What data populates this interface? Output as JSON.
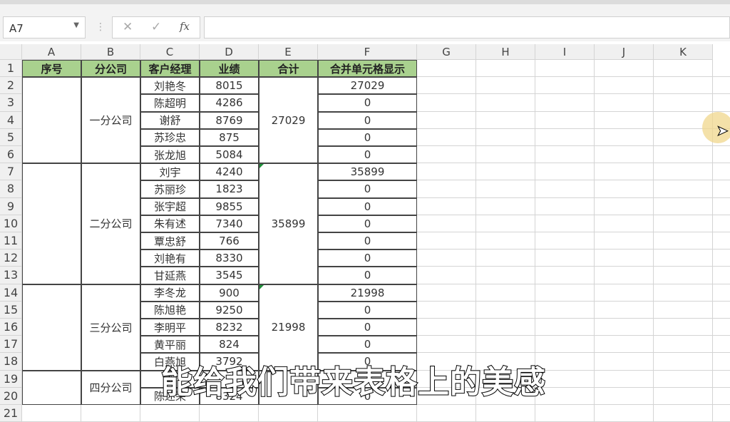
{
  "namebox": {
    "value": "A7"
  },
  "formula": {
    "cancel_icon": "✕",
    "enter_icon": "✓",
    "fx_label": "fx",
    "value": ""
  },
  "columns": [
    "A",
    "B",
    "C",
    "D",
    "E",
    "F",
    "G",
    "H",
    "I",
    "J",
    "K"
  ],
  "rows": [
    "1",
    "2",
    "3",
    "4",
    "5",
    "6",
    "7",
    "8",
    "9",
    "10",
    "11",
    "12",
    "13",
    "14",
    "15",
    "16",
    "17",
    "18",
    "19",
    "20",
    "21"
  ],
  "headers": [
    "序号",
    "分公司",
    "客户经理",
    "业绩",
    "合计",
    "合并单元格显示"
  ],
  "groups": [
    {
      "branch": "一分公司",
      "total": "27029",
      "start": 2,
      "end": 6
    },
    {
      "branch": "二分公司",
      "total": "35899",
      "start": 7,
      "end": 13
    },
    {
      "branch": "三分公司",
      "total": "21998",
      "start": 14,
      "end": 18
    },
    {
      "branch": "四分公司",
      "total": "",
      "start": 19,
      "end": 20
    }
  ],
  "records": [
    {
      "name": "刘艳冬",
      "value": "8015",
      "display": "27029"
    },
    {
      "name": "陈超明",
      "value": "4286",
      "display": "0"
    },
    {
      "name": "谢舒",
      "value": "8769",
      "display": "0"
    },
    {
      "name": "苏珍忠",
      "value": "875",
      "display": "0"
    },
    {
      "name": "张龙旭",
      "value": "5084",
      "display": "0"
    },
    {
      "name": "刘宇",
      "value": "4240",
      "display": "35899"
    },
    {
      "name": "苏丽珍",
      "value": "1823",
      "display": "0"
    },
    {
      "name": "张宇超",
      "value": "9855",
      "display": "0"
    },
    {
      "name": "朱有述",
      "value": "7340",
      "display": "0"
    },
    {
      "name": "覃忠舒",
      "value": "766",
      "display": "0"
    },
    {
      "name": "刘艳有",
      "value": "8330",
      "display": "0"
    },
    {
      "name": "甘延燕",
      "value": "3545",
      "display": "0"
    },
    {
      "name": "李冬龙",
      "value": "900",
      "display": "21998"
    },
    {
      "name": "陈旭艳",
      "value": "9250",
      "display": "0"
    },
    {
      "name": "李明平",
      "value": "8232",
      "display": "0"
    },
    {
      "name": "黄平丽",
      "value": "824",
      "display": "0"
    },
    {
      "name": "白燕旭",
      "value": "3792",
      "display": "0"
    },
    {
      "name": "刘",
      "value": "",
      "display": ""
    },
    {
      "name": "陈述荣",
      "value": "8324",
      "display": "0"
    }
  ],
  "subtitle": "能给我们带来表格上的美感"
}
